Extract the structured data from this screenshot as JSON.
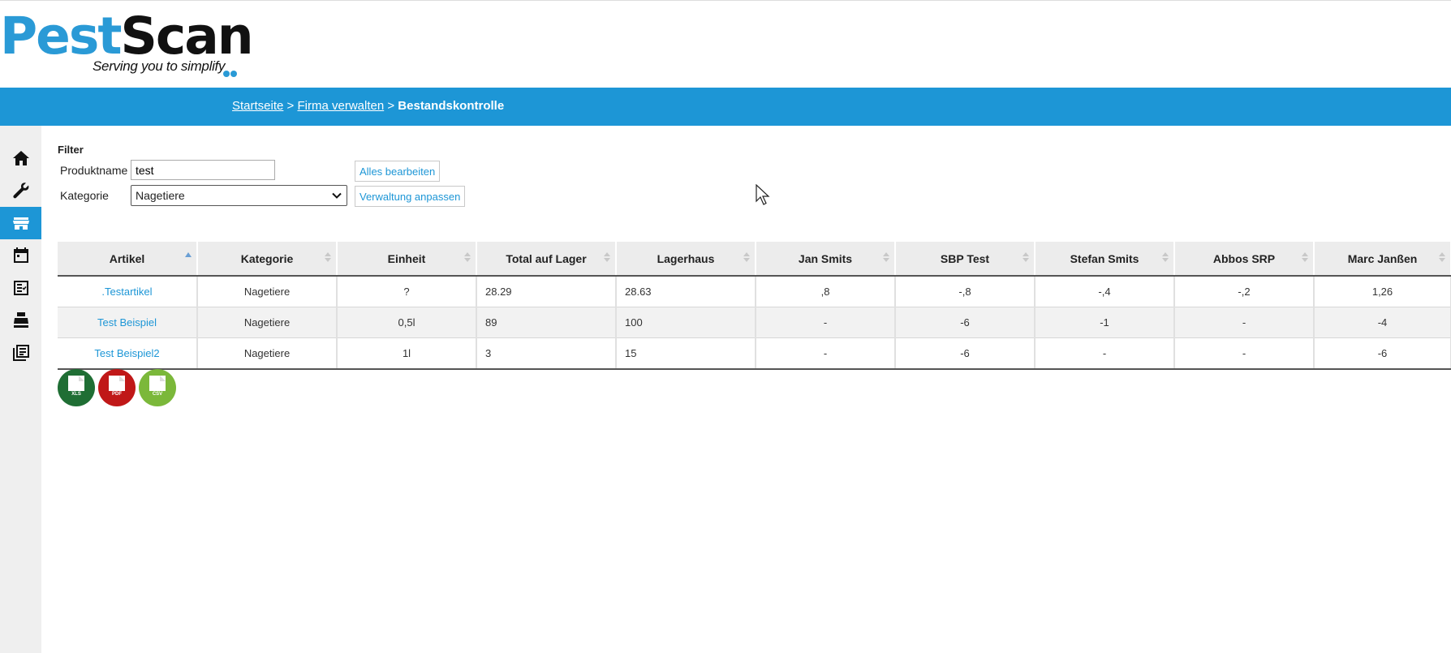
{
  "logo": {
    "part1": "Pest",
    "part2": "Scan",
    "tagline": "Serving you to simplify"
  },
  "breadcrumb": {
    "home": "Startseite",
    "sep1": " > ",
    "company": "Firma verwalten",
    "sep2": " > ",
    "current": "Bestandskontrolle"
  },
  "sidebar": {
    "items": [
      {
        "icon": "home-icon"
      },
      {
        "icon": "wrench-icon"
      },
      {
        "icon": "store-icon",
        "active": true
      },
      {
        "icon": "calendar-icon"
      },
      {
        "icon": "checklist-icon"
      },
      {
        "icon": "cash-register-icon"
      },
      {
        "icon": "library-icon"
      }
    ]
  },
  "filter": {
    "title": "Filter",
    "product_label": "Produktname",
    "product_value": "test",
    "category_label": "Kategorie",
    "category_value": "Nagetiere",
    "edit_all_button": "Alles bearbeiten",
    "adjust_button": "Verwaltung anpassen"
  },
  "table": {
    "columns": [
      "Artikel",
      "Kategorie",
      "Einheit",
      "Total auf Lager",
      "Lagerhaus",
      "Jan Smits",
      "SBP Test",
      "Stefan Smits",
      "Abbos SRP",
      "Marc Janßen"
    ],
    "rows": [
      [
        ".Testartikel",
        "Nagetiere",
        "?",
        "28.29",
        "28.63",
        ",8",
        "-,8",
        "-,4",
        "-,2",
        "1,26"
      ],
      [
        "Test Beispiel",
        "Nagetiere",
        "0,5l",
        "89",
        "100",
        "-",
        "-6",
        "-1",
        "-",
        "-4"
      ],
      [
        "Test Beispiel2",
        "Nagetiere",
        "1l",
        "3",
        "15",
        "-",
        "-6",
        "-",
        "-",
        "-6"
      ]
    ]
  },
  "exports": [
    {
      "label": "XLS",
      "color": "#1f6e34"
    },
    {
      "label": "PDF",
      "color": "#c01818"
    },
    {
      "label": "CSV",
      "color": "#7bb83a"
    }
  ],
  "colors": {
    "accent": "#1d96d6",
    "positive": "#2a7a2a",
    "warning": "#f0a020",
    "negative": "#d9241b"
  }
}
